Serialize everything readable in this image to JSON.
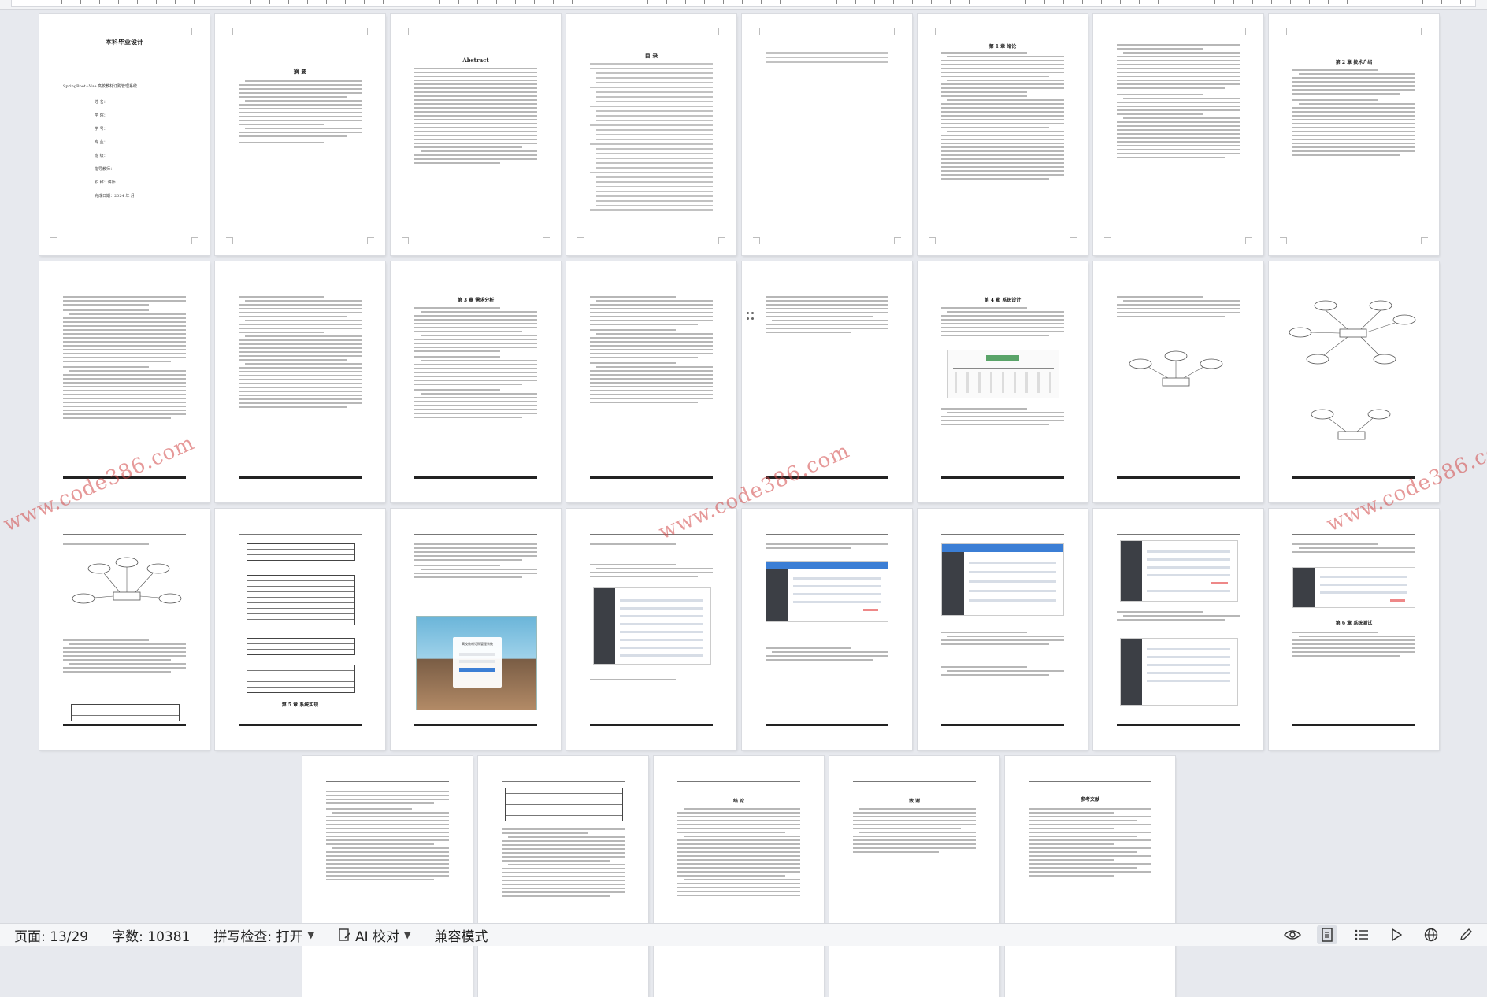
{
  "status_bar": {
    "page_label": "页面: 13/29",
    "word_count": "字数: 10381",
    "spell_check": "拼写检查: 打开",
    "ai_proof": "AI 校对",
    "compat_mode": "兼容模式"
  },
  "watermark": "www.code386.com",
  "pages": {
    "cover_title": "本科毕业设计",
    "cover_subtitle": "SpringBoot+Vue 高校教材订购管理系统",
    "cover_fields": [
      "姓 名：",
      "学 院：",
      "学 号：",
      "专 业：",
      "班 级：",
      "指导教师：",
      "职 称：讲师",
      "完成日期：2024 年 月"
    ],
    "abstract_cn": "摘 要",
    "abstract_en": "Abstract",
    "toc": "目 录",
    "ch1": "第 1 章 绪论",
    "ch2": "第 2 章 技术介绍",
    "ch3": "第 3 章 需求分析",
    "ch4": "第 4 章 系统设计",
    "ch5": "第 5 章 系统实现",
    "ch6": "第 6 章 系统测试",
    "conclusion": "结 论",
    "thanks": "致 谢",
    "references": "参考文献",
    "login_title": "高校教材订购管理系统"
  },
  "colors": {
    "watermark": "#d24646",
    "status_bg": "#f5f6f8",
    "canvas_bg": "#e7e9ee"
  },
  "icons": [
    "eye-icon",
    "page-view-icon",
    "outline-icon",
    "play-icon",
    "globe-icon",
    "pen-icon"
  ]
}
